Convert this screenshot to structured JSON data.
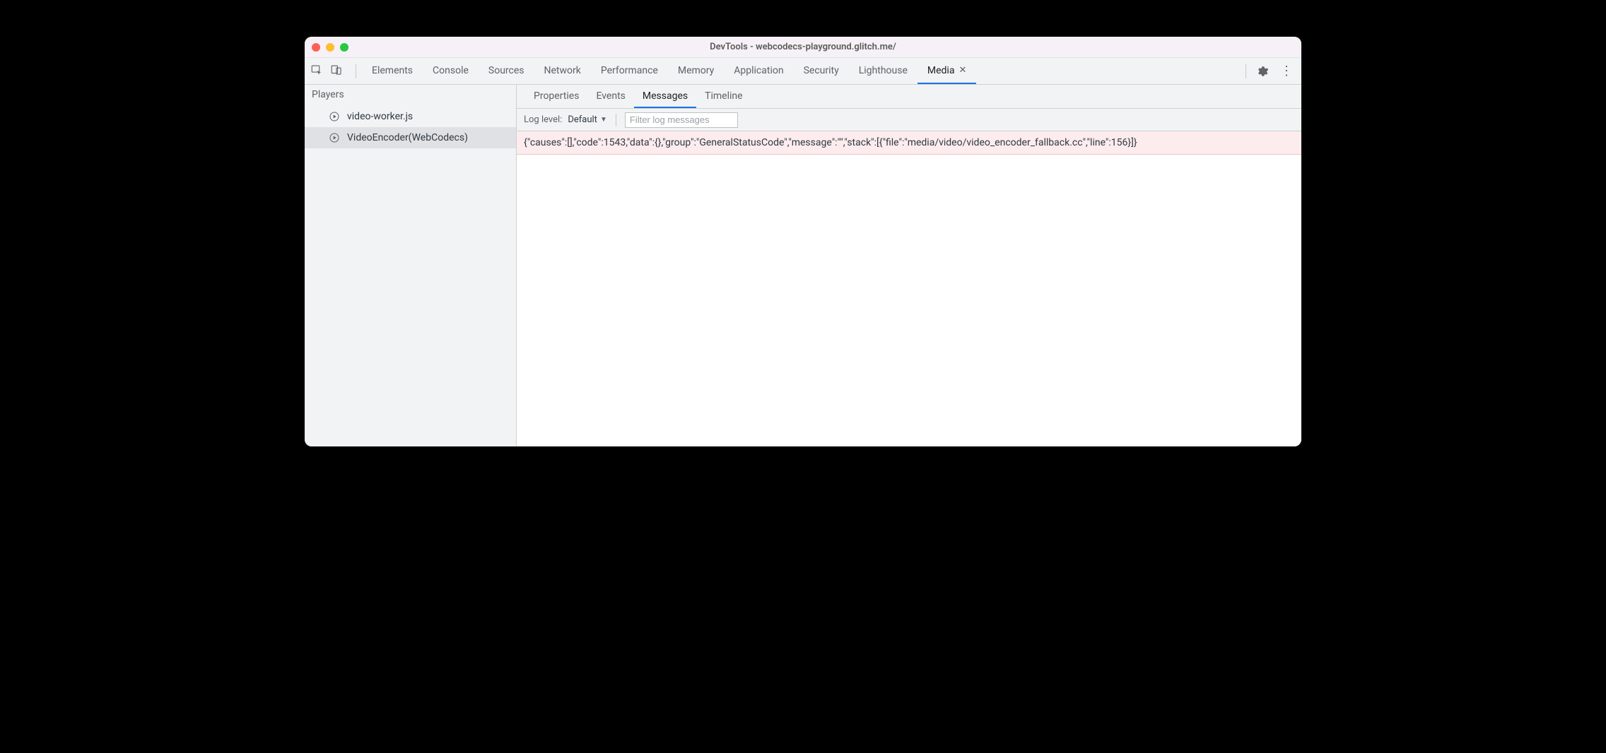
{
  "window": {
    "title": "DevTools - webcodecs-playground.glitch.me/"
  },
  "main_tabs": [
    {
      "label": "Elements",
      "active": false,
      "closable": false
    },
    {
      "label": "Console",
      "active": false,
      "closable": false
    },
    {
      "label": "Sources",
      "active": false,
      "closable": false
    },
    {
      "label": "Network",
      "active": false,
      "closable": false
    },
    {
      "label": "Performance",
      "active": false,
      "closable": false
    },
    {
      "label": "Memory",
      "active": false,
      "closable": false
    },
    {
      "label": "Application",
      "active": false,
      "closable": false
    },
    {
      "label": "Security",
      "active": false,
      "closable": false
    },
    {
      "label": "Lighthouse",
      "active": false,
      "closable": false
    },
    {
      "label": "Media",
      "active": true,
      "closable": true
    }
  ],
  "sidebar": {
    "heading": "Players",
    "players": [
      {
        "label": "video-worker.js",
        "selected": false
      },
      {
        "label": "VideoEncoder(WebCodecs)",
        "selected": true
      }
    ]
  },
  "sub_tabs": [
    {
      "label": "Properties",
      "active": false
    },
    {
      "label": "Events",
      "active": false
    },
    {
      "label": "Messages",
      "active": true
    },
    {
      "label": "Timeline",
      "active": false
    }
  ],
  "toolbar": {
    "log_level_label": "Log level:",
    "log_level_value": "Default",
    "filter_placeholder": "Filter log messages"
  },
  "messages": [
    "{\"causes\":[],\"code\":1543,\"data\":{},\"group\":\"GeneralStatusCode\",\"message\":\"\",\"stack\":[{\"file\":\"media/video/video_encoder_fallback.cc\",\"line\":156}]}"
  ]
}
